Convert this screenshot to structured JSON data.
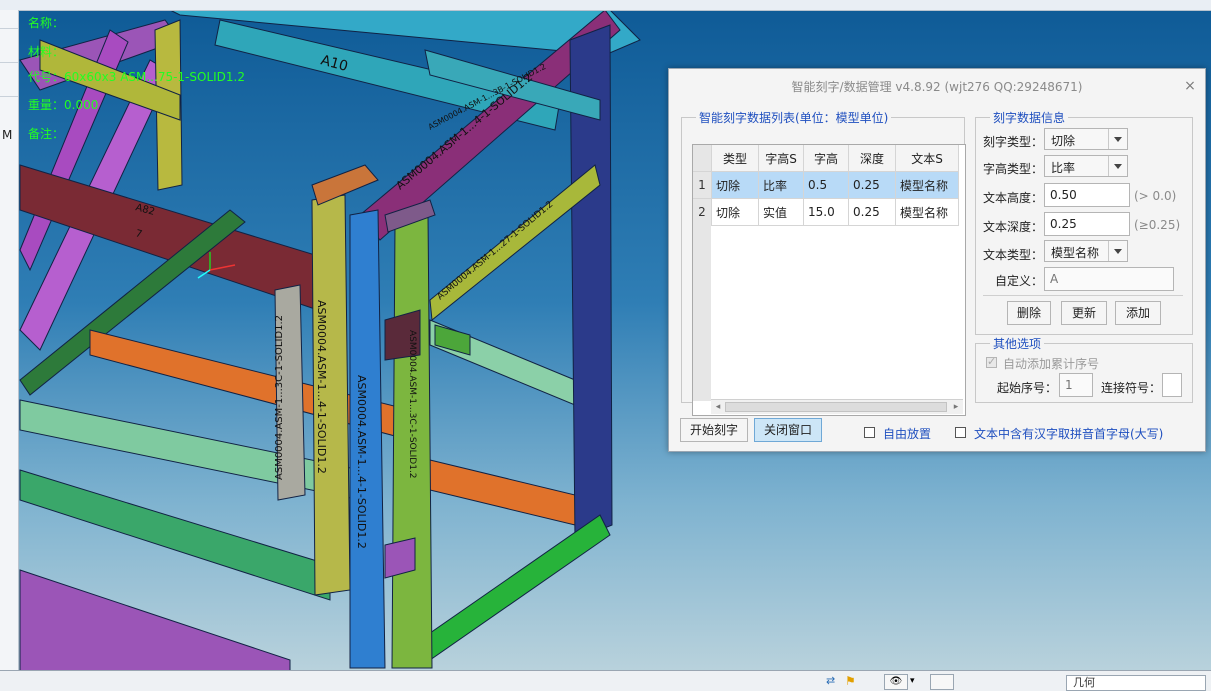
{
  "info": {
    "line1": "名称：",
    "line2": "材料：",
    "line3": "代号：60x60x3 ASM...75-1-SOLID1.2",
    "line4": "重量：0.000",
    "line5": "备注："
  },
  "left_panel": {
    "letter": "M"
  },
  "model_labels": {
    "a10": "A10",
    "top_beam": "ASM0004.ASM-1...4-1-SOLID1.2",
    "diag": "ASM0004.ASM-1...3B-1-SOLID1.2",
    "upright1": "ASM0004.ASM-1...3C-1-SOLID1.2",
    "upright2": "ASM0004.ASM-1...4-1-SOLID1.2",
    "upright3": "ASM0004.ASM-1...4-1-SOLID1.2",
    "beam2": "ASM0004.ASM-1...27-1-SOLID1.2",
    "beam3": "ASM0004.ASM-1...3C-1-SOLID1.2",
    "a82": "A82",
    "a7": "7"
  },
  "dialog": {
    "title": "智能刻字/数据管理 v4.8.92 (wjt276 QQ:29248671)",
    "close": "×",
    "list_group": "智能刻字数据列表(单位：模型单位)",
    "columns": [
      "类型",
      "字高S",
      "字高",
      "深度",
      "文本S"
    ],
    "rows": [
      {
        "n": "1",
        "cells": [
          "切除",
          "比率",
          "0.5",
          "0.25",
          "模型名称"
        ]
      },
      {
        "n": "2",
        "cells": [
          "切除",
          "实值",
          "15.0",
          "0.25",
          "模型名称"
        ]
      }
    ],
    "info_group": "刻字数据信息",
    "engrave_type_label": "刻字类型：",
    "engrave_type_value": "切除",
    "height_type_label": "字高类型：",
    "height_type_value": "比率",
    "text_height_label": "文本高度：",
    "text_height_value": "0.50",
    "text_height_hint": "(> 0.0)",
    "text_depth_label": "文本深度：",
    "text_depth_value": "0.25",
    "text_depth_hint": "(≥0.25)",
    "text_type_label": "文本类型：",
    "text_type_value": "模型名称",
    "custom_label": "自定义：",
    "custom_placeholder": "A",
    "delete": "删除",
    "update": "更新",
    "add": "添加",
    "other_group": "其他选项",
    "auto_seq": "自动添加累计序号",
    "start_seq_label": "起始序号：",
    "start_seq_placeholder": "1",
    "connector_label": "连接符号：",
    "start_btn": "开始刻字",
    "close_btn": "关闭窗口",
    "free_place": "自由放置",
    "pinyin": "文本中含有汉字取拼音首字母(大写)"
  },
  "statusbar": {
    "field": "几何"
  }
}
